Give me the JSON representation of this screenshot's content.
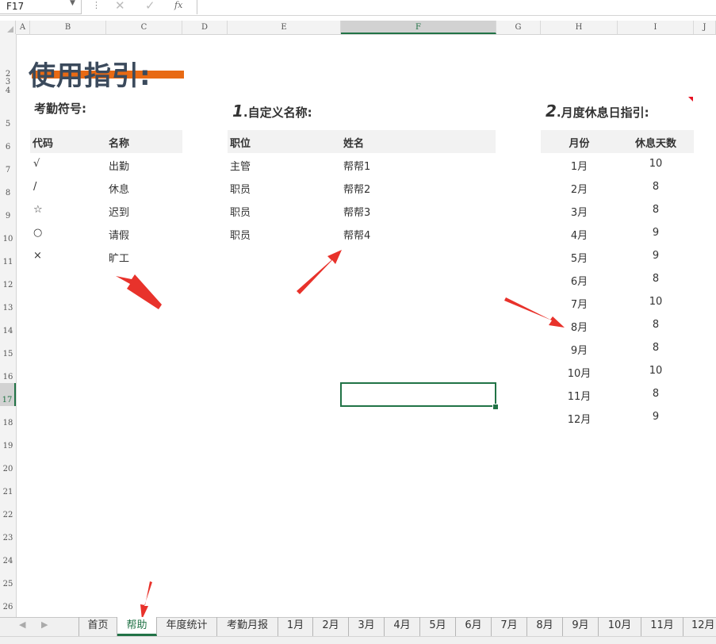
{
  "formula_bar": {
    "name_box": "F17",
    "fx": "fx"
  },
  "columns": [
    "A",
    "B",
    "C",
    "D",
    "E",
    "F",
    "G",
    "H",
    "I",
    "J"
  ],
  "rows": [
    "2",
    "3",
    "4",
    "5",
    "6",
    "7",
    "8",
    "9",
    "10",
    "11",
    "12",
    "13",
    "14",
    "15",
    "16",
    "17",
    "18",
    "19",
    "20",
    "21",
    "22",
    "23",
    "24",
    "25",
    "26"
  ],
  "selected_cell": "F17",
  "title": "使用指引:",
  "attendance": {
    "title": "考勤符号:",
    "headers": [
      "代码",
      "名称"
    ],
    "rows": [
      [
        "√",
        "出勤"
      ],
      [
        "/",
        "休息"
      ],
      [
        "☆",
        "迟到"
      ],
      [
        "○",
        "请假"
      ],
      [
        "×",
        "旷工"
      ]
    ]
  },
  "custom_names": {
    "num": "1",
    "title": ".自定义名称:",
    "headers": [
      "职位",
      "姓名"
    ],
    "rows": [
      [
        "主管",
        "帮帮1"
      ],
      [
        "职员",
        "帮帮2"
      ],
      [
        "职员",
        "帮帮3"
      ],
      [
        "职员",
        "帮帮4"
      ]
    ]
  },
  "monthly_rest": {
    "num": "2",
    "title": ".月度休息日指引:",
    "headers": [
      "月份",
      "休息天数"
    ],
    "rows": [
      [
        "1月",
        "10"
      ],
      [
        "2月",
        "8"
      ],
      [
        "3月",
        "8"
      ],
      [
        "4月",
        "9"
      ],
      [
        "5月",
        "9"
      ],
      [
        "6月",
        "8"
      ],
      [
        "7月",
        "10"
      ],
      [
        "8月",
        "8"
      ],
      [
        "9月",
        "8"
      ],
      [
        "10月",
        "10"
      ],
      [
        "11月",
        "8"
      ],
      [
        "12月",
        "9"
      ]
    ]
  },
  "tabs": [
    "首页",
    "帮助",
    "年度统计",
    "考勤月报",
    "1月",
    "2月",
    "3月",
    "4月",
    "5月",
    "6月",
    "7月",
    "8月",
    "9月",
    "10月",
    "11月",
    "12月"
  ],
  "active_tab": "帮助",
  "colors": {
    "accent": "#217346",
    "title_bar": "#e86a14",
    "arrow": "#e8322b",
    "title_text": "#3b4a5c"
  }
}
